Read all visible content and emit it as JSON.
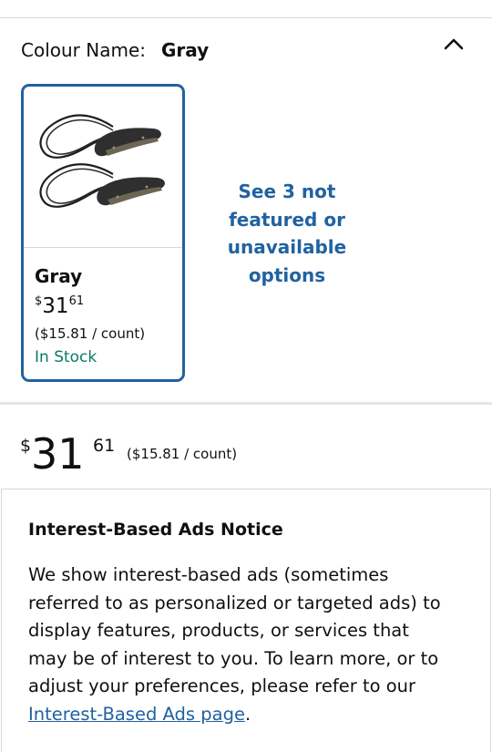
{
  "variation": {
    "label": "Colour Name:",
    "selected_value": "Gray",
    "collapse_icon": "chevron-up-icon"
  },
  "swatch": {
    "name": "Gray",
    "price_symbol": "$",
    "price_whole": "31",
    "price_fraction": "61",
    "unit_price": "($15.81 / count)",
    "availability": "In Stock",
    "border_color": "#2162a1",
    "stock_color": "#067d62"
  },
  "see_more": {
    "line1": "See 3 not",
    "line2": "featured or",
    "line3": "unavailable",
    "line4": "options"
  },
  "price": {
    "symbol": "$",
    "whole": "31",
    "fraction": "61",
    "unit_price": "($15.81 / count)"
  },
  "ads_notice": {
    "title": "Interest-Based Ads Notice",
    "line1": "We show interest-based ads (sometimes",
    "line2": "referred to as personalized or targeted ads) to",
    "line3": "display features, products, or services that",
    "line4": "may be of interest to you. To learn more, or to",
    "line5": "adjust your preferences, please refer to our",
    "link_text": "Interest-Based Ads page",
    "after_link": "."
  }
}
